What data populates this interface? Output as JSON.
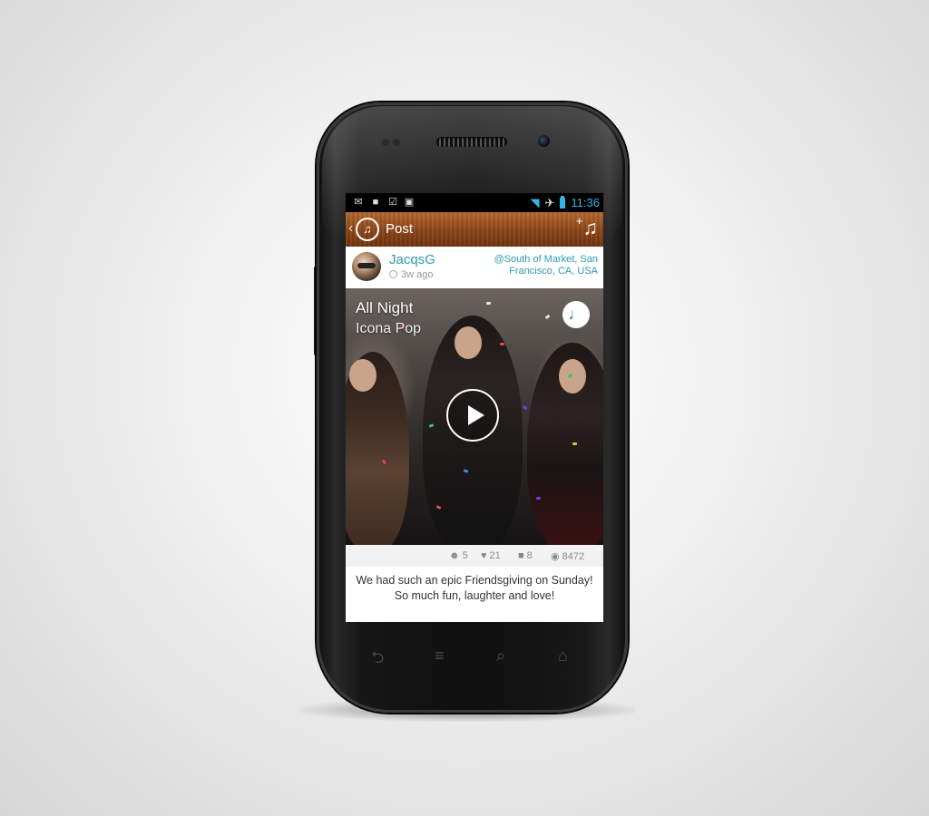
{
  "status_bar": {
    "time": "11:36",
    "notification_icons": [
      "gmail-icon",
      "chat-icon",
      "download-done-icon",
      "shopping-bag-icon"
    ],
    "status_icons": [
      "wifi-icon",
      "airplane-icon",
      "battery-icon"
    ],
    "accent_color": "#33b5e5"
  },
  "action_bar": {
    "title": "Post",
    "back_icon": "chevron-left-icon",
    "logo_icon": "music-chat-logo-icon",
    "action_icon": "add-music-icon",
    "color": "#8a4417"
  },
  "post": {
    "username": "JacqsG",
    "time_ago": "3w ago",
    "location": "@South of Market, San Francisco, CA, USA",
    "song": {
      "title": "All Night",
      "artist": "Icona Pop"
    },
    "media_icons": [
      "music-note-icon",
      "play-icon"
    ],
    "stats": {
      "smiles": "5",
      "likes": "21",
      "comments": "8",
      "views": "8472"
    },
    "caption": "We had such an epic Friendsgiving on Sunday!\nSo much fun, laughter and love!",
    "accent_color": "#2b9db0"
  },
  "nav_keys": [
    "back-icon",
    "menu-icon",
    "search-icon",
    "home-icon"
  ]
}
